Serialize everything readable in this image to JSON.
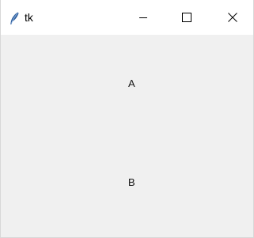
{
  "window": {
    "title": "tk",
    "icon": "tk-feather-icon",
    "controls": [
      "minimize-icon",
      "maximize-icon",
      "close-icon"
    ]
  },
  "content": {
    "label_a": "A",
    "label_b": "B"
  },
  "colors": {
    "titlebar_bg": "#ffffff",
    "window_bg": "#f0f0f0",
    "text": "#1a1a1a",
    "feather": "#2f5f9e"
  }
}
